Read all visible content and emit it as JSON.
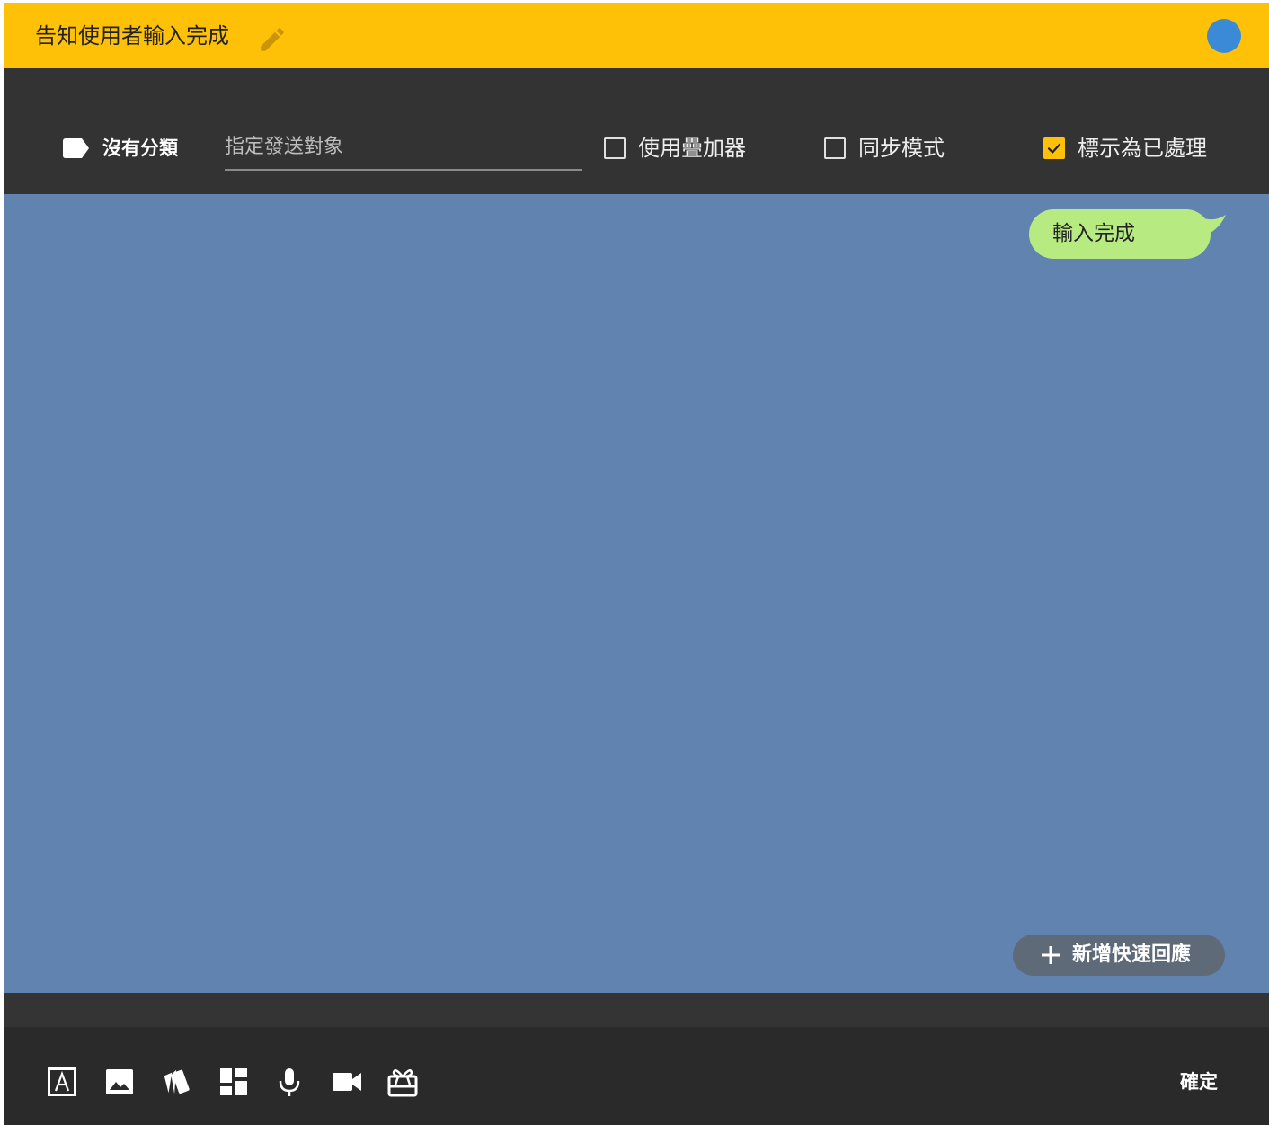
{
  "title_bar": {
    "title": "告知使用者輸入完成",
    "edit_icon": "pencil-icon",
    "status_color": "#3a8ad8"
  },
  "options_bar": {
    "category_icon": "label-tag-icon",
    "category_label": "沒有分類",
    "target_placeholder": "指定發送對象",
    "target_value": "",
    "checkboxes": [
      {
        "label": "使用疊加器",
        "checked": false
      },
      {
        "label": "同步模式",
        "checked": false
      },
      {
        "label": "標示為已處理",
        "checked": true
      }
    ]
  },
  "canvas": {
    "bubble_text": "輸入完成",
    "quick_reply_label": "新增快速回應"
  },
  "toolbar": {
    "icons": [
      "text-icon",
      "image-icon",
      "cards-icon",
      "layout-icon",
      "microphone-icon",
      "video-icon",
      "gift-icon"
    ],
    "confirm_label": "確定"
  },
  "colors": {
    "accent": "#ffc107",
    "canvas_bg": "#6183b0",
    "bubble_bg": "#b8ea82",
    "dark_bg": "#2a2a2a"
  }
}
